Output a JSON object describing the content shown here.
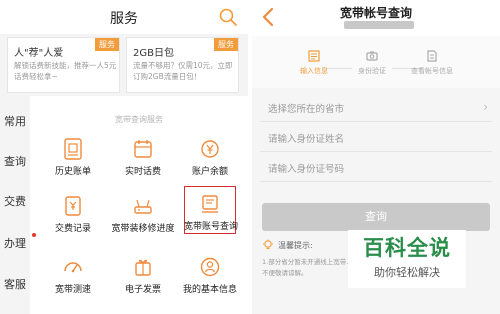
{
  "left_panel": {
    "title": "服务",
    "promos": [
      {
        "title": "人\"荐\"人爱",
        "desc": "解锁话费新技能，推荐一人5元话费轻松拿~",
        "tag": "服务"
      },
      {
        "title": "2GB日包",
        "desc": "流量不够用？仅需10元，立即订购2GB流量日包！",
        "tag": "服务"
      }
    ],
    "sidebar": [
      "常用",
      "查询",
      "交费",
      "办理",
      "客服"
    ],
    "section_label": "宽带查询服务",
    "tiles": [
      {
        "label": "历史账单",
        "icon": "bill-icon"
      },
      {
        "label": "实时话费",
        "icon": "calendar-icon"
      },
      {
        "label": "账户余额",
        "icon": "yen-coin-icon"
      },
      {
        "label": "交费记录",
        "icon": "payment-record-icon"
      },
      {
        "label": "宽带装移修进度",
        "icon": "router-icon"
      },
      {
        "label": "宽带账号查询",
        "icon": "account-card-icon"
      },
      {
        "label": "宽带测速",
        "icon": "speedometer-icon"
      },
      {
        "label": "电子发票",
        "icon": "gift-invoice-icon"
      },
      {
        "label": "我的基本信息",
        "icon": "user-info-icon"
      }
    ]
  },
  "right_panel": {
    "title": "宽带帐号查询",
    "steps": [
      "输入信息",
      "身份验证",
      "查看帐号信息"
    ],
    "fields": [
      {
        "placeholder": "选择您所在的省市",
        "has_chevron": true
      },
      {
        "placeholder": "请输入身份证姓名",
        "has_chevron": false
      },
      {
        "placeholder": "请输入身份证号码",
        "has_chevron": false
      }
    ],
    "query_button": "查询",
    "tip_title": "温馨提示:",
    "tip_text": "1.部分省分暂未开通线上宽带…结您带来不便敬请谅解。",
    "chevron": "›"
  },
  "watermark": {
    "main": "百科全说",
    "sub": "助你轻松解决"
  },
  "colors": {
    "accent_orange": "#f39c3b",
    "highlight_red": "#d92c2c",
    "brand_green": "#2a8e4b"
  }
}
